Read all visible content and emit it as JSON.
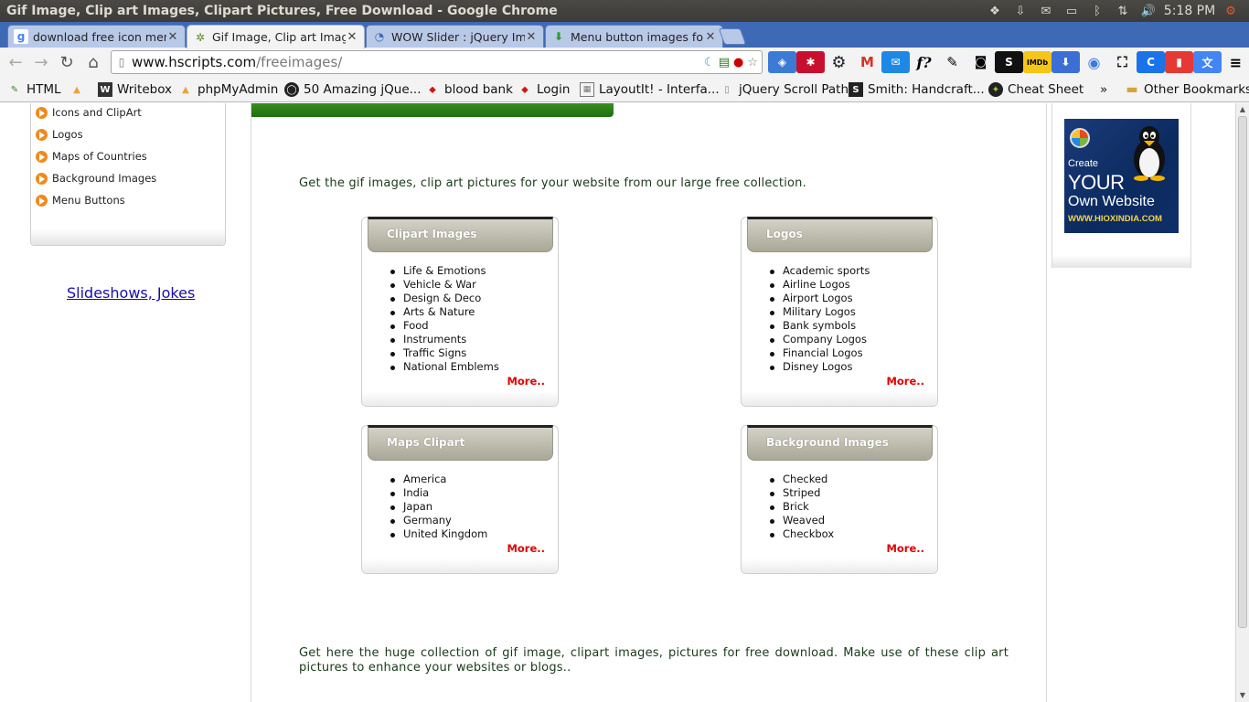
{
  "os": {
    "window_title": "Gif Image, Clip art Images, Clipart Pictures, Free Download - Google Chrome",
    "clock": "5:18 PM"
  },
  "tabs": [
    {
      "label": "download free icon menu",
      "icon": "google-icon",
      "active": false
    },
    {
      "label": "Gif Image, Clip art Images,",
      "icon": "hscripts-icon",
      "active": true
    },
    {
      "label": "WOW Slider : jQuery Imag",
      "icon": "loading-icon",
      "active": false
    },
    {
      "label": "Menu button images for c",
      "icon": "download-arrow-icon",
      "active": false
    }
  ],
  "toolbar": {
    "url_host": "www.hscripts.com",
    "url_path": "/freeimages/"
  },
  "bookmarks": [
    {
      "label": "HTML"
    },
    {
      "label": ""
    },
    {
      "label": "Writebox"
    },
    {
      "label": "phpMyAdmin"
    },
    {
      "label": "50 Amazing jQue..."
    },
    {
      "label": "blood bank"
    },
    {
      "label": "Login"
    },
    {
      "label": "LayoutIt! - Interfa..."
    },
    {
      "label": "jQuery Scroll Path"
    },
    {
      "label": "Smith: Handcraft..."
    },
    {
      "label": "Cheat Sheet"
    },
    {
      "label": "»"
    },
    {
      "label": "Other Bookmarks"
    }
  ],
  "left_panel": {
    "items": [
      "Icons and ClipArt",
      "Logos",
      "Maps of Countries",
      "Background Images",
      "Menu Buttons"
    ],
    "slideshow_link": "Slideshows, Jokes"
  },
  "main": {
    "intro": "Get the gif images, clip art pictures for your website from our large free collection.",
    "outro": "Get here the huge collection of gif image, clipart images, pictures for free download. Make use of these clip art pictures to enhance your websites or blogs..",
    "boxes": [
      {
        "title": "Clipart Images",
        "items": [
          "Life & Emotions",
          "Vehicle & War",
          "Design & Deco",
          "Arts & Nature",
          "Food",
          "Instruments",
          "Traffic Signs",
          "National Emblems"
        ],
        "more": "More.."
      },
      {
        "title": "Logos",
        "items": [
          "Academic sports",
          "Airline Logos",
          "Airport Logos",
          "Military Logos",
          "Bank symbols",
          "Company Logos",
          "Financial Logos",
          "Disney Logos"
        ],
        "more": "More.."
      },
      {
        "title": "Maps Clipart",
        "items": [
          "America",
          "India",
          "Japan",
          "Germany",
          "United Kingdom"
        ],
        "more": "More.."
      },
      {
        "title": "Background Images",
        "items": [
          "Checked",
          "Striped",
          "Brick",
          "Weaved",
          "Checkbox"
        ],
        "more": "More.."
      }
    ]
  },
  "ad": {
    "line1": "Create",
    "line2": "YOUR",
    "line3": "Own Website",
    "line4": "WWW.HIOXINDIA.COM"
  },
  "colors": {
    "tabstrip": "#3e6ab5",
    "green_bar": "#2a7d17",
    "more_link": "#e00000",
    "box_caption": "#bab8a9",
    "link": "#1a0dab"
  }
}
